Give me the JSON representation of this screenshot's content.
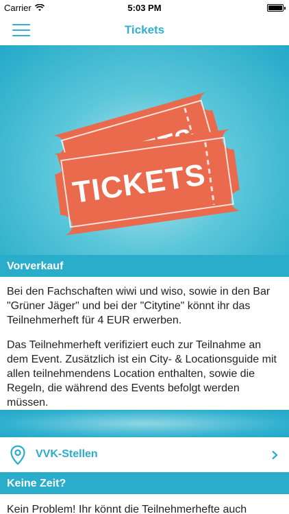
{
  "status_bar": {
    "carrier": "Carrier",
    "time": "5:03 PM"
  },
  "nav": {
    "title": "Tickets"
  },
  "hero": {
    "ticket_text": "TICKETS",
    "back_ticket_text": "TICKETS"
  },
  "presale": {
    "heading": "Vorverkauf",
    "paragraph_1": "Bei den Fachschaften wiwi und wiso, sowie in den Bar \"Grüner Jäger\" und bei der \"Citytine\" könnt ihr das Teilnehmerheft für 4 EUR erwerben.",
    "paragraph_2": "Das Teilnehmerheft verifiziert euch zur Teilnahme an dem Event. Zusätzlich ist ein City- & Locationsguide mit allen teilnehmendens Location enthalten, sowie die Regeln, die während des Events befolgt werden müssen."
  },
  "vvk": {
    "label": "VVK-Stellen"
  },
  "no_time": {
    "heading": "Keine Zeit?",
    "text": "Kein Problem! Ihr könnt die Teilnehmerhefte auch"
  },
  "colors": {
    "accent": "#2fb0cf",
    "ticket": "#e96a4d"
  }
}
